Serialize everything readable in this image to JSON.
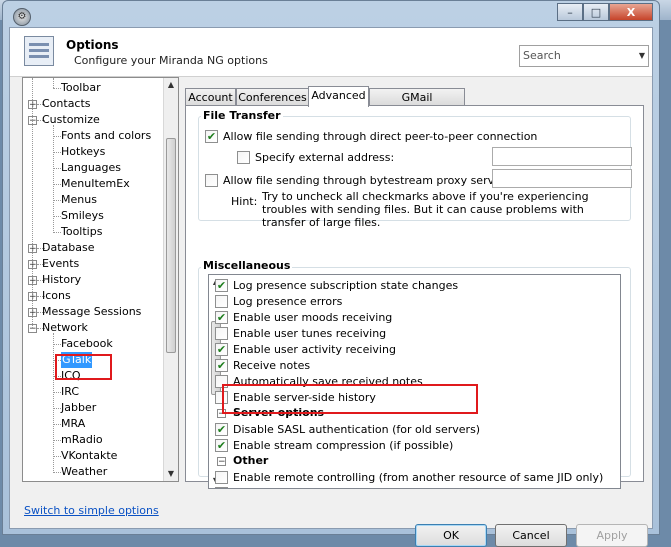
{
  "header": {
    "title": "Options",
    "subtitle": "Configure your Miranda NG options",
    "search_placeholder": "Search"
  },
  "window_controls": {
    "minimize": "–",
    "maximize": "□",
    "close": "X"
  },
  "tree": [
    {
      "label": "Toolbar",
      "level": 2
    },
    {
      "label": "Contacts",
      "level": 1,
      "toggle": "+"
    },
    {
      "label": "Customize",
      "level": 1,
      "toggle": "−"
    },
    {
      "label": "Fonts and colors",
      "level": 2
    },
    {
      "label": "Hotkeys",
      "level": 2
    },
    {
      "label": "Languages",
      "level": 2
    },
    {
      "label": "MenuItemEx",
      "level": 2
    },
    {
      "label": "Menus",
      "level": 2
    },
    {
      "label": "Smileys",
      "level": 2
    },
    {
      "label": "Tooltips",
      "level": 2
    },
    {
      "label": "Database",
      "level": 1,
      "toggle": "+"
    },
    {
      "label": "Events",
      "level": 1,
      "toggle": "+"
    },
    {
      "label": "History",
      "level": 1,
      "toggle": "+"
    },
    {
      "label": "Icons",
      "level": 1,
      "toggle": "+"
    },
    {
      "label": "Message Sessions",
      "level": 1,
      "toggle": "+"
    },
    {
      "label": "Network",
      "level": 1,
      "toggle": "−"
    },
    {
      "label": "Facebook",
      "level": 2
    },
    {
      "label": "GTalk",
      "level": 2,
      "selected": true
    },
    {
      "label": "ICQ",
      "level": 2
    },
    {
      "label": "IRC",
      "level": 2
    },
    {
      "label": "Jabber",
      "level": 2
    },
    {
      "label": "MRA",
      "level": 2
    },
    {
      "label": "mRadio",
      "level": 2
    },
    {
      "label": "VKontakte",
      "level": 2
    },
    {
      "label": "Weather",
      "level": 2
    }
  ],
  "simple_link": "Switch to simple options",
  "tabs": [
    "Account",
    "Conferences",
    "Advanced",
    "GMail notifications"
  ],
  "active_tab": "Advanced",
  "file_transfer": {
    "title": "File Transfer",
    "p2p_label": "Allow file sending through direct peer-to-peer connection",
    "p2p_checked": true,
    "ext_addr_label": "Specify external address:",
    "ext_addr_value": "",
    "proxy_label": "Allow file sending through bytestream proxy server:",
    "proxy_value": "",
    "hint_label": "Hint:",
    "hint_text": "Try to uncheck all checkmarks above if you're experiencing troubles with sending files. But it can cause problems with transfer of large files."
  },
  "misc": {
    "title": "Miscellaneous",
    "rows": [
      {
        "label": "Log presence subscription state changes",
        "checked": true
      },
      {
        "label": "Log presence errors",
        "checked": false
      },
      {
        "label": "Enable user moods receiving",
        "checked": true
      },
      {
        "label": "Enable user tunes receiving",
        "checked": false
      },
      {
        "label": "Enable user activity receiving",
        "checked": true
      },
      {
        "label": "Receive notes",
        "checked": true
      },
      {
        "label": "Automatically save received notes",
        "checked": false
      },
      {
        "label": "Enable server-side history",
        "checked": false
      },
      {
        "label": "Server options",
        "group": true
      },
      {
        "label": "Disable SASL authentication (for old servers)",
        "checked": true
      },
      {
        "label": "Enable stream compression (if possible)",
        "checked": true
      },
      {
        "label": "Other",
        "group": true
      },
      {
        "label": "Enable remote controlling (from another resource of same JID only)",
        "checked": false
      },
      {
        "label": "",
        "checked": false
      }
    ]
  },
  "buttons": {
    "ok": "OK",
    "cancel": "Cancel",
    "apply": "Apply"
  },
  "colors": {
    "selection": "#3399ff",
    "highlight": "#e0191c",
    "link": "#0b52c4"
  }
}
